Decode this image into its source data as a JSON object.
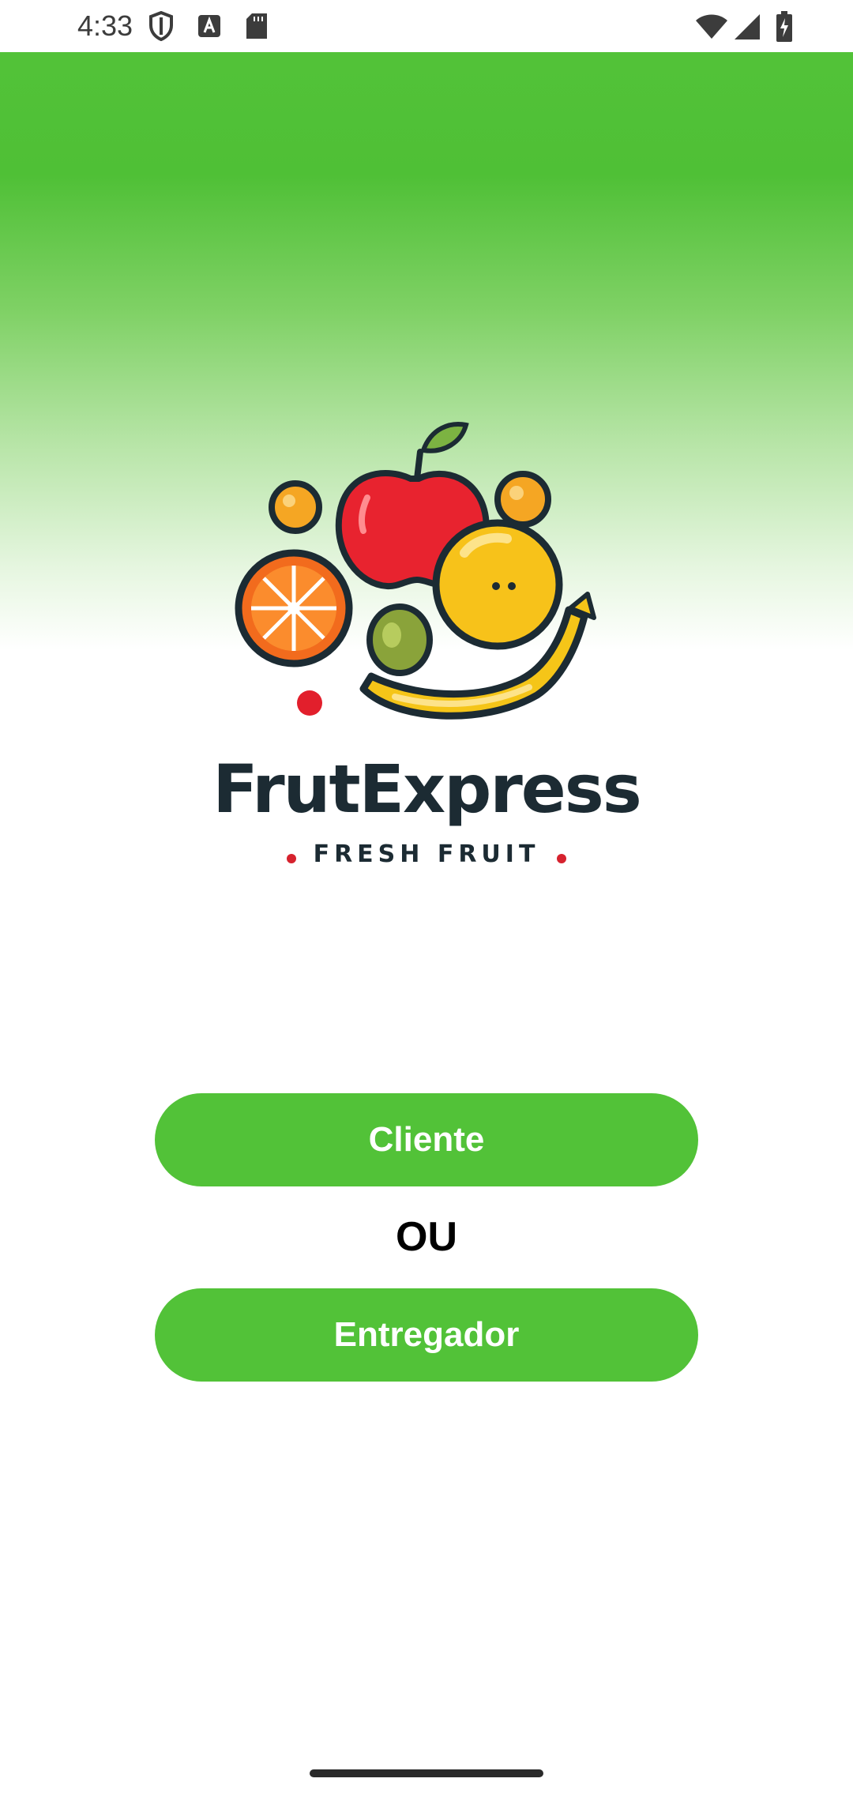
{
  "status_bar": {
    "time": "4:33",
    "icons_left": [
      "shield-icon",
      "font-a-icon",
      "sd-card-icon"
    ],
    "icons_right": [
      "wifi-icon",
      "signal-icon",
      "battery-charging-icon"
    ]
  },
  "brand": {
    "name": "FrutExpress",
    "tagline": "FRESH FRUIT"
  },
  "actions": {
    "cliente_label": "Cliente",
    "separator": "OU",
    "entregador_label": "Entregador"
  },
  "colors": {
    "primary_green": "#52c238",
    "button_text": "#ffffff",
    "brand_text": "#1c2b33",
    "accent_red": "#d6222e"
  }
}
